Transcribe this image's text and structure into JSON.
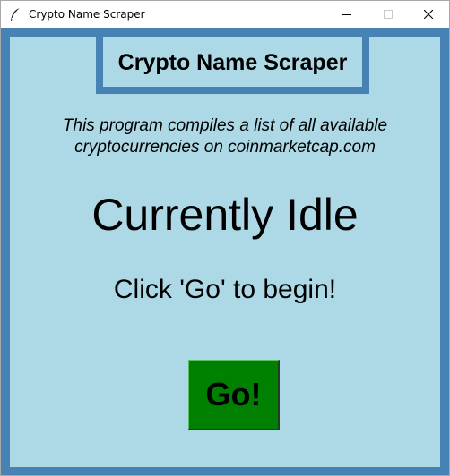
{
  "window": {
    "title": "Crypto Name Scraper",
    "icon": "feather-icon",
    "controls": [
      "minimize-icon",
      "maximize-icon",
      "close-icon"
    ]
  },
  "app": {
    "title": "Crypto Name Scraper",
    "description_line1": "This program compiles a list of all available",
    "description_line2": "cryptocurrencies on coinmarketcap.com",
    "status": "Currently Idle",
    "instruction": "Click 'Go' to begin!",
    "go_label": "Go!"
  },
  "colors": {
    "border": "#4682b4",
    "background": "#add8e6",
    "go_button": "#008000"
  }
}
